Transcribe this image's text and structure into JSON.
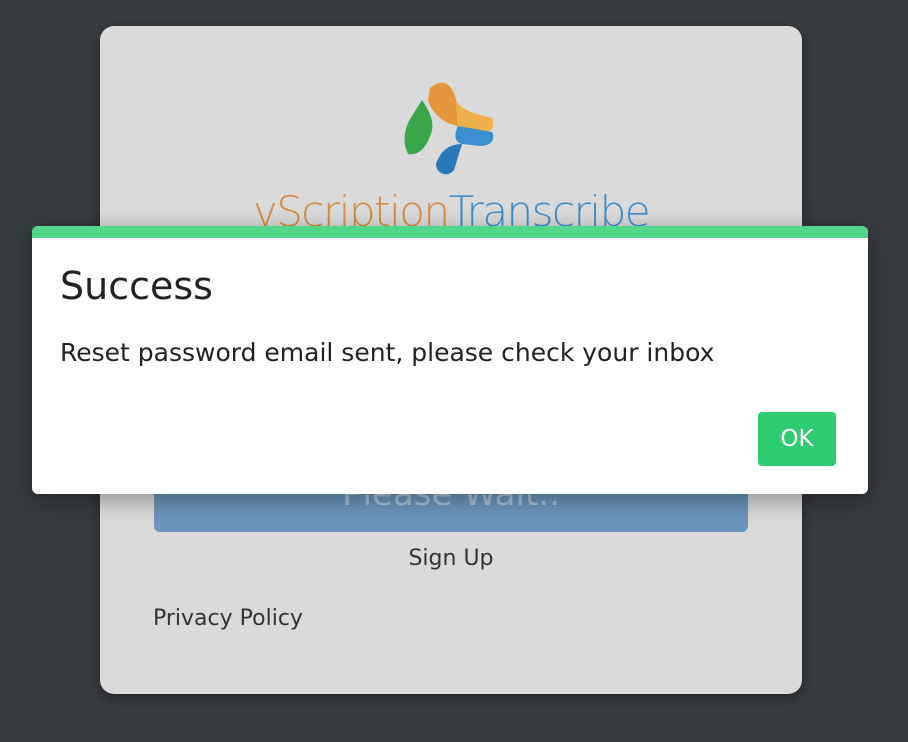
{
  "login": {
    "logo_text_part1": "vScription",
    "logo_text_part2": "Transcribe",
    "submit_label": "Please Wait..",
    "signup_label": "Sign Up",
    "privacy_label": "Privacy Policy"
  },
  "dialog": {
    "title": "Success",
    "message": "Reset password email sent, please check your inbox",
    "ok_label": "OK"
  },
  "colors": {
    "background": "#383b3f",
    "card": "#dadada",
    "accent_bar": "#52d68a",
    "ok_button": "#2ecc71",
    "submit_button": "#6d95bc",
    "logo_orange": "#d88a3c",
    "logo_blue": "#3b8fcd",
    "logo_green": "#3aa64a"
  },
  "icons": {
    "logo": "vscription-logo-icon"
  }
}
